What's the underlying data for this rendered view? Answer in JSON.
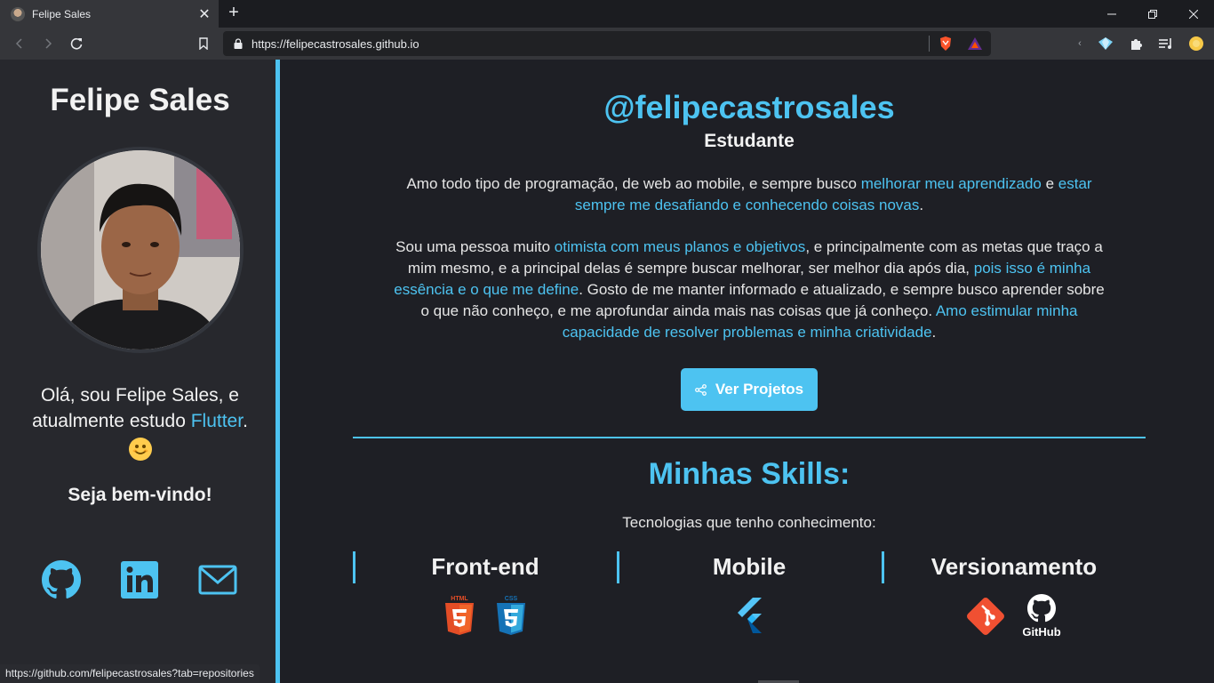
{
  "browser": {
    "tab_title": "Felipe Sales",
    "tab_close": "✕",
    "new_tab": "+",
    "url": "https://felipecastrosales.github.io",
    "status_url": "https://github.com/felipecastrosales?tab=repositories"
  },
  "sidebar": {
    "name": "Felipe Sales",
    "intro_prefix": "Olá, sou Felipe Sales, e atualmente estudo ",
    "intro_link": "Flutter",
    "intro_suffix": ".",
    "welcome": "Seja bem-vindo!",
    "socials": [
      {
        "icon": "github-icon"
      },
      {
        "icon": "linkedin-icon"
      },
      {
        "icon": "mail-icon"
      }
    ]
  },
  "main": {
    "handle": "@felipecastrosales",
    "role": "Estudante",
    "para1": [
      {
        "text": "Amo todo tipo de programação, de web ao mobile, e sempre busco ",
        "accent": false
      },
      {
        "text": "melhorar meu aprendizado",
        "accent": true
      },
      {
        "text": " e ",
        "accent": false
      },
      {
        "text": "estar sempre me desafiando e conhecendo coisas novas",
        "accent": true
      },
      {
        "text": ".",
        "accent": false
      }
    ],
    "para2": [
      {
        "text": "Sou uma pessoa muito ",
        "accent": false
      },
      {
        "text": "otimista com meus planos e objetivos",
        "accent": true
      },
      {
        "text": ", e principalmente com as metas que traço a mim mesmo, e a principal delas é sempre buscar melhorar, ser melhor dia após dia, ",
        "accent": false
      },
      {
        "text": "pois isso é minha essência e o que me define",
        "accent": true
      },
      {
        "text": ". Gosto de me manter informado e atualizado, e sempre busco aprender sobre o que não conheço, e me aprofundar ainda mais nas coisas que já conheço. ",
        "accent": false
      },
      {
        "text": "Amo estimular minha capacidade de resolver problemas e minha criatividade",
        "accent": true
      },
      {
        "text": ".",
        "accent": false
      }
    ],
    "projects_button": "Ver Projetos",
    "skills_title": "Minhas Skills:",
    "skills_subtitle": "Tecnologias que tenho conhecimento:",
    "skills": [
      {
        "title": "Front-end",
        "icons": [
          "html5-icon",
          "css3-icon"
        ],
        "labels": [
          "HTML",
          "CSS"
        ]
      },
      {
        "title": "Mobile",
        "icons": [
          "flutter-icon"
        ]
      },
      {
        "title": "Versionamento",
        "icons": [
          "git-icon",
          "github-icon"
        ],
        "labels": [
          "GitHub"
        ]
      }
    ]
  },
  "colors": {
    "accent": "#4dc3f1",
    "sidebar_bg": "#27282d",
    "main_bg": "#1e1f25",
    "html5": "#e44d26",
    "css3": "#1572b6",
    "git": "#f05032"
  }
}
